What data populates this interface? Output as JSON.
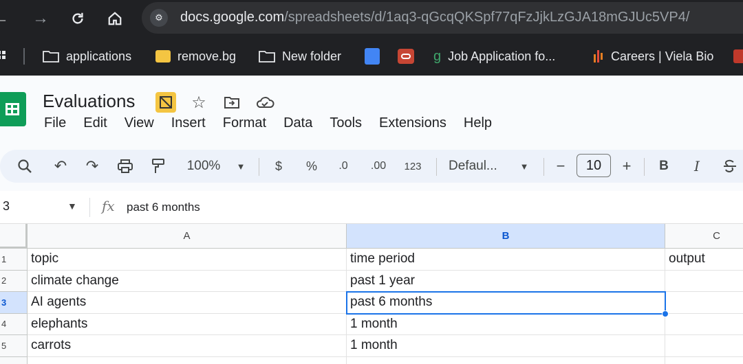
{
  "browser": {
    "url_host": "docs.google.com",
    "url_path": "/spreadsheets/d/1aq3-qGcqQKSpf77qFzJjkLzGJA18mGJUc5VP4/",
    "bookmarks": [
      {
        "label": "applications",
        "icon": "folder-icon"
      },
      {
        "label": "remove.bg",
        "icon": "removebg-icon"
      },
      {
        "label": "New folder",
        "icon": "folder-icon"
      },
      {
        "label": "",
        "icon": "docs-icon"
      },
      {
        "label": "",
        "icon": "oracle-icon"
      },
      {
        "label": "Job Application fo...",
        "icon": "greenhouse-icon"
      },
      {
        "label": "Careers | Viela Bio",
        "icon": "viela-icon"
      }
    ]
  },
  "doc": {
    "title": "Evaluations",
    "menu": [
      "File",
      "Edit",
      "View",
      "Insert",
      "Format",
      "Data",
      "Tools",
      "Extensions",
      "Help"
    ]
  },
  "toolbar": {
    "zoom": "100%",
    "currency": "$",
    "percent": "%",
    "dec_decrease": ".0",
    "dec_increase": ".00",
    "number_format": "123",
    "font": "Defaul...",
    "font_size": "10",
    "minus": "−",
    "plus": "+",
    "bold": "B",
    "italic": "I"
  },
  "formula_bar": {
    "cell_ref": "3",
    "fx": "fx",
    "formula": "past 6 months"
  },
  "sheet": {
    "columns": [
      "A",
      "B",
      "C"
    ],
    "rows": [
      {
        "num": "1",
        "a": "topic",
        "b": "time period",
        "c": "output"
      },
      {
        "num": "2",
        "a": "climate change",
        "b": "past 1 year",
        "c": ""
      },
      {
        "num": "3",
        "a": "AI agents",
        "b": "past 6 months",
        "c": ""
      },
      {
        "num": "4",
        "a": "elephants",
        "b": "1 month",
        "c": ""
      },
      {
        "num": "5",
        "a": "carrots",
        "b": "1 month",
        "c": ""
      }
    ]
  },
  "colors": {
    "accent": "#1a73e8",
    "sheets_green": "#0f9d58",
    "selection_header": "#d3e3fd"
  }
}
